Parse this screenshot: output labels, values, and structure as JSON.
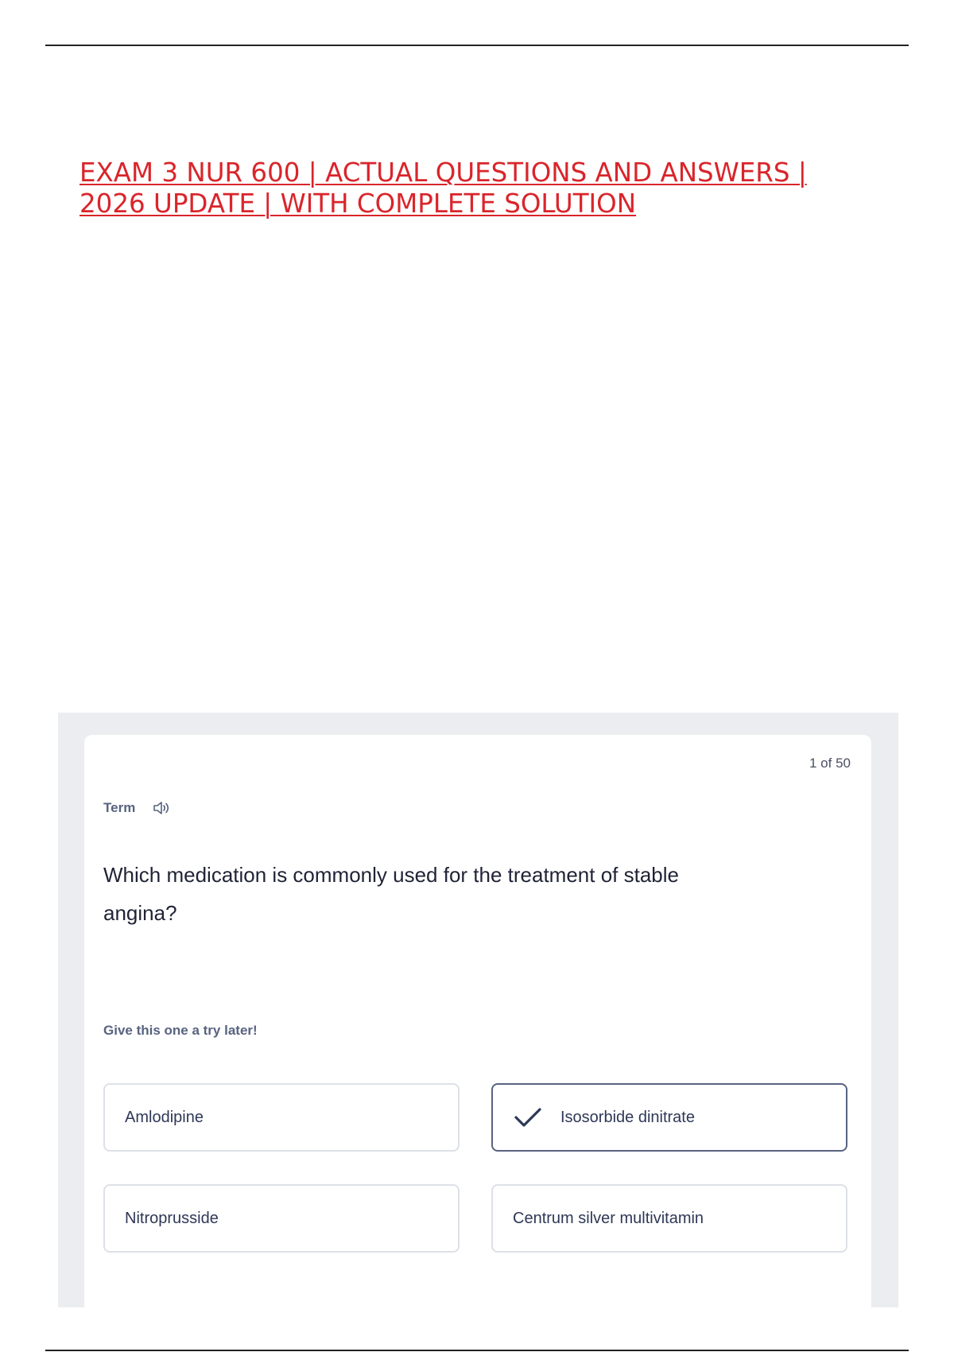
{
  "document": {
    "title_lines": [
      "EXAM 3 NUR 600 | ACTUAL QUESTIONS AND ANSWERS |",
      "2026 UPDATE | WITH COMPLETE SOLUTION"
    ],
    "title_color": "#d9252b"
  },
  "flashcard": {
    "counter": "1 of 50",
    "term_label": "Term",
    "audio_icon": "speaker-icon",
    "question": "Which medication is commonly used for the treatment of stable angina?",
    "hint": "Give this one a try later!",
    "options": [
      {
        "label": "Amlodipine",
        "selected": false
      },
      {
        "label": "Isosorbide dinitrate",
        "selected": true,
        "icon": "checkmark-icon"
      },
      {
        "label": "Nitroprusside",
        "selected": false
      },
      {
        "label": "Centrum silver multivitamin",
        "selected": false
      }
    ],
    "colors": {
      "background": "#ecedf0",
      "card": "#ffffff",
      "muted_text": "#586380",
      "selected_border": "#586380",
      "option_border": "#dde0e7"
    }
  }
}
